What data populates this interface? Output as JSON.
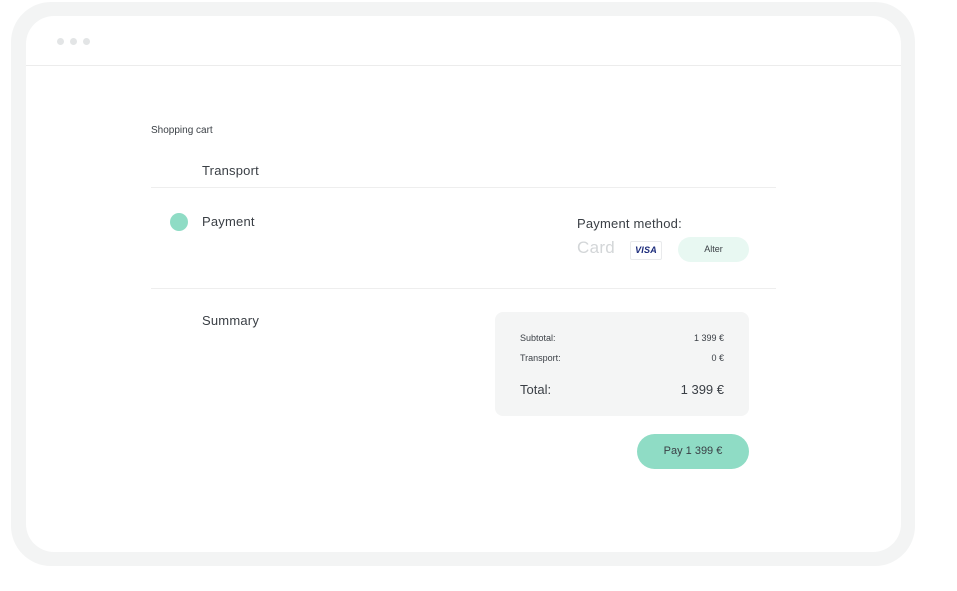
{
  "breadcrumb": "Shopping cart",
  "steps": {
    "transport": "Transport",
    "payment": "Payment",
    "summary": "Summary"
  },
  "payment_method": {
    "label": "Payment method:",
    "type": "Card",
    "card_brand": "VISA",
    "alter_label": "Alter"
  },
  "summary": {
    "subtotal_label": "Subtotal:",
    "subtotal_value": "1 399 €",
    "transport_label": "Transport:",
    "transport_value": "0 €",
    "total_label": "Total:",
    "total_value": "1 399 €"
  },
  "pay_button": "Pay 1 399 €",
  "colors": {
    "accent": "#8fdcc5",
    "accent_light": "#e8f8f2",
    "text": "#3a3f45",
    "panel": "#f4f5f5"
  }
}
